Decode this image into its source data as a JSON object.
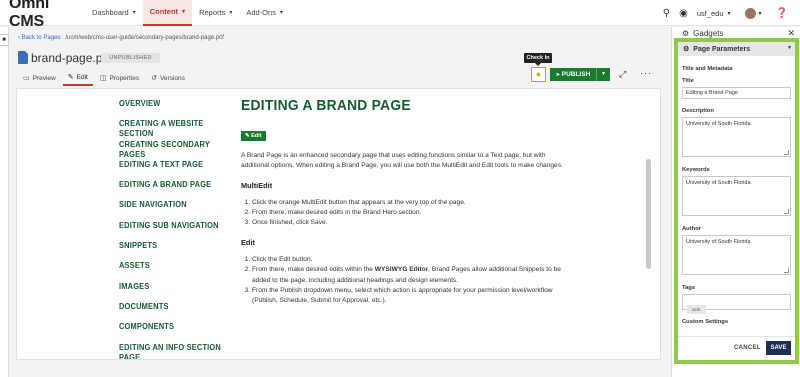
{
  "app": {
    "logo": "Omni CMS"
  },
  "topnav": {
    "items": [
      {
        "label": "Dashboard"
      },
      {
        "label": "Content"
      },
      {
        "label": "Reports"
      },
      {
        "label": "Add-Ons"
      }
    ],
    "user": "usf_edu"
  },
  "page": {
    "back_label": "Back to Pages",
    "path": "/ucm/web/cms-user-guide/secondary-pages/brand-page.pcf",
    "filename": "brand-page.pcf",
    "status": "UNPUBLISHED",
    "tabs": [
      {
        "label": "Preview"
      },
      {
        "label": "Edit"
      },
      {
        "label": "Properties"
      },
      {
        "label": "Versions"
      }
    ],
    "checkin_tooltip": "Check In",
    "publish_label": "PUBLISH"
  },
  "sidenav": [
    "OVERVIEW",
    "CREATING A WEBSITE SECTION",
    "CREATING SECONDARY PAGES",
    "EDITING A TEXT PAGE",
    "EDITING A BRAND PAGE",
    "SIDE NAVIGATION",
    "EDITING SUB NAVIGATION",
    "SNIPPETS",
    "ASSETS",
    "IMAGES",
    "DOCUMENTS",
    "COMPONENTS",
    "EDITING AN INFO SECTION PAGE"
  ],
  "article": {
    "title": "EDITING A BRAND PAGE",
    "edit_label": "Edit",
    "intro": "A Brand Page is an enhanced secondary page that uses editing functions similar to a Text page, but with additional options. When editing a Brand Page, you will use both the MultiEdit and Edit tools to make changes.",
    "multiedit_heading": "MultiEdit",
    "multiedit_steps": [
      "Click the orange MultiEdit button that appears at the very top of the page.",
      "From there, make desired edits in the Brand Hero section.",
      "Once finished, click Save."
    ],
    "edit_heading": "Edit",
    "edit_step1": "Click the Edit button.",
    "edit_step2_pre": "From there, make desired edits within the ",
    "edit_step2_bold": "WYSIWYG Editor",
    "edit_step2_post": ". Brand Pages allow additional Snippets to be added to the page, including additional headings and design elements.",
    "edit_step3": "From the Publish dropdown menu, select which action is appropriate for your permission level/workflow (Publish, Schedule, Submit for Approval, etc.)."
  },
  "gadgets": {
    "title": "Gadgets",
    "panel_title": "Page Parameters",
    "section_title": "Title and Metadata",
    "title_label": "Title",
    "title_value": "Editing a Brand Page",
    "description_label": "Description",
    "description_value": "University of South Florida",
    "keywords_label": "Keywords",
    "keywords_value": "University of South Florida",
    "author_label": "Author",
    "author_value": "University of South Florida",
    "tags_label": "Tags",
    "tag_chip": "ucm",
    "custom_settings_label": "Custom Settings",
    "cancel_label": "CANCEL",
    "save_label": "SAVE"
  },
  "colors": {
    "brand_green": "#155a30",
    "publish_green": "#1a7a2f",
    "highlight_border": "#8fc84a",
    "save_navy": "#1e2f55",
    "active_nav": "#c0392b"
  }
}
